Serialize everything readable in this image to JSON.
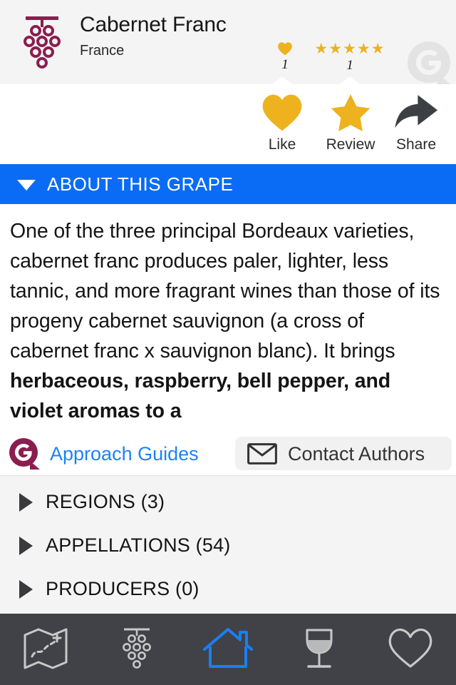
{
  "header": {
    "grape_icon": "grape-cluster-icon",
    "title": "Cabernet Franc",
    "subtitle": "France",
    "watermark": "approach-guides-g-watermark",
    "stats": {
      "like_icon": "heart-icon",
      "like_count": "1",
      "stars_icon": "five-stars-icon",
      "stars": "★★★★★",
      "rating_count": "1"
    }
  },
  "actions": [
    {
      "id": "like",
      "icon": "heart-icon",
      "label": "Like"
    },
    {
      "id": "review",
      "icon": "star-icon",
      "label": "Review"
    },
    {
      "id": "share",
      "icon": "share-arrow-icon",
      "label": "Share"
    }
  ],
  "about_section": {
    "toggle_icon": "triangle-down-icon",
    "title": "ABOUT THIS GRAPE",
    "expanded": true,
    "text_plain": "One of the three principal Bordeaux varieties, cabernet franc produces paler, lighter, less tannic, and more fragrant wines than those of its progeny cabernet sauvignon (a cross of cabernet franc x sauvignon blanc). It brings ",
    "text_bold": "herbaceous, raspberry, bell pepper, and violet aromas to a"
  },
  "author_row": {
    "logo_icon": "approach-guides-g-logo",
    "link_label": "Approach Guides",
    "contact": {
      "icon": "envelope-icon",
      "label": "Contact Authors"
    }
  },
  "sections": [
    {
      "icon": "triangle-right-icon",
      "label": "REGIONS (3)"
    },
    {
      "icon": "triangle-right-icon",
      "label": "APPELLATIONS (54)"
    },
    {
      "icon": "triangle-right-icon",
      "label": "PRODUCERS (0)"
    }
  ],
  "tabbar": [
    {
      "id": "map",
      "icon": "map-icon",
      "active": false
    },
    {
      "id": "grapes",
      "icon": "grape-cluster-icon",
      "active": false
    },
    {
      "id": "home",
      "icon": "house-icon",
      "active": true
    },
    {
      "id": "wines",
      "icon": "wine-glass-icon",
      "active": false
    },
    {
      "id": "saved",
      "icon": "heart-outline-icon",
      "active": false
    }
  ],
  "colors": {
    "accent_blue": "#0a6cf5",
    "link_blue": "#1d82f5",
    "gold": "#edb21e",
    "maroon": "#8b1e4e",
    "tabbar_bg": "#404247",
    "page_bg": "#f4f4f4"
  }
}
